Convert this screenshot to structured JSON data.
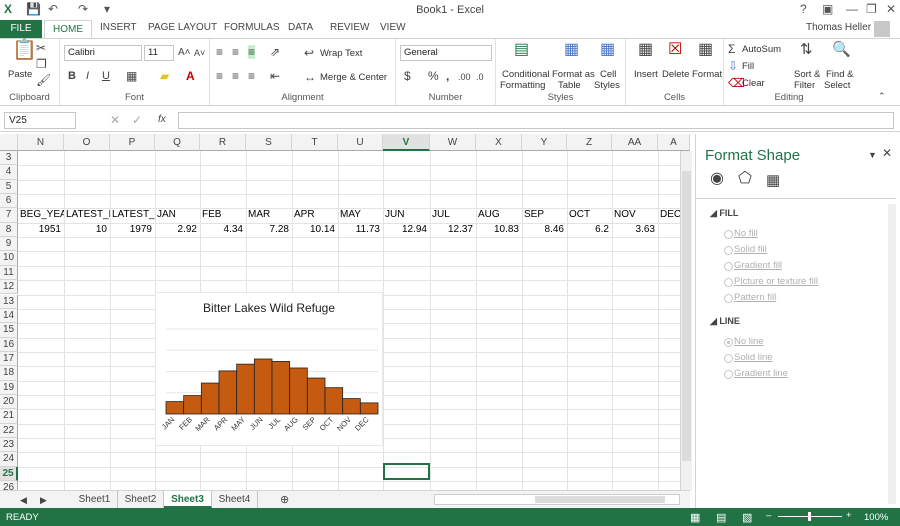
{
  "window": {
    "title": "Book1 - Excel",
    "help": "?",
    "user": "Thomas Heller"
  },
  "ribbon_tabs": [
    "FILE",
    "HOME",
    "INSERT",
    "PAGE LAYOUT",
    "FORMULAS",
    "DATA",
    "REVIEW",
    "VIEW"
  ],
  "clipboard": {
    "paste": "Paste",
    "label": "Clipboard"
  },
  "font": {
    "name": "Calibri",
    "size": "11",
    "label": "Font",
    "bold": "B",
    "italic": "I",
    "underline": "U"
  },
  "alignment": {
    "wrap": "Wrap Text",
    "merge": "Merge & Center",
    "label": "Alignment"
  },
  "number": {
    "format": "General",
    "label": "Number",
    "currency": "$",
    "percent": "%",
    "comma": ","
  },
  "styles": {
    "conditional": "Conditional",
    "conditional2": "Formatting",
    "format_as": "Format as",
    "table": "Table",
    "cell": "Cell",
    "styles_word": "Styles",
    "label": "Styles"
  },
  "cells": {
    "insert": "Insert",
    "delete": "Delete",
    "format": "Format",
    "label": "Cells"
  },
  "editing": {
    "autosum": "AutoSum",
    "fill": "Fill",
    "clear": "Clear",
    "sort": "Sort &",
    "filter": "Filter",
    "find": "Find &",
    "select": "Select",
    "label": "Editing"
  },
  "formula_bar": {
    "name_box": "V25",
    "fx": "fx",
    "value": ""
  },
  "columns": [
    "N",
    "O",
    "P",
    "Q",
    "R",
    "S",
    "T",
    "U",
    "V",
    "W",
    "X",
    "Y",
    "Z",
    "AA",
    "A"
  ],
  "rows": [
    "3",
    "4",
    "5",
    "6",
    "7",
    "8",
    "9",
    "10",
    "11",
    "12",
    "13",
    "14",
    "15",
    "16",
    "17",
    "18",
    "19",
    "20",
    "21",
    "22",
    "23",
    "24",
    "25",
    "26"
  ],
  "row7": [
    "BEG_YEAR",
    "LATEST_M",
    "LATEST_YE",
    "JAN",
    "FEB",
    "MAR",
    "APR",
    "MAY",
    "JUN",
    "JUL",
    "AUG",
    "SEP",
    "OCT",
    "NOV",
    "DEC"
  ],
  "row8": [
    "1951",
    "10",
    "1979",
    "2.92",
    "4.34",
    "7.28",
    "10.14",
    "11.73",
    "12.94",
    "12.37",
    "10.83",
    "8.46",
    "6.2",
    "3.63"
  ],
  "chart_data": {
    "type": "bar",
    "title": "Bitter Lakes Wild Refuge",
    "categories": [
      "JAN",
      "FEB",
      "MAR",
      "APR",
      "MAY",
      "JUN",
      "JUL",
      "AUG",
      "SEP",
      "OCT",
      "NOV",
      "DEC"
    ],
    "values": [
      2.92,
      4.34,
      7.28,
      10.14,
      11.73,
      12.94,
      12.37,
      10.83,
      8.46,
      6.2,
      3.63,
      2.62
    ],
    "ylim": [
      0,
      20
    ],
    "grid": true,
    "bar_color": "#c55a11"
  },
  "sheets": [
    "Sheet1",
    "Sheet2",
    "Sheet3",
    "Sheet4"
  ],
  "active_sheet": "Sheet3",
  "status": {
    "ready": "READY",
    "zoom": "100%"
  },
  "format_pane": {
    "title": "Format Shape",
    "fill_section": "FILL",
    "fill_options": [
      "No fill",
      "Solid fill",
      "Gradient fill",
      "Picture or texture fill",
      "Pattern fill"
    ],
    "line_section": "LINE",
    "line_options": [
      "No line",
      "Solid line",
      "Gradient line"
    ]
  },
  "colors": {
    "accent": "#217346",
    "bar": "#c55a11"
  }
}
